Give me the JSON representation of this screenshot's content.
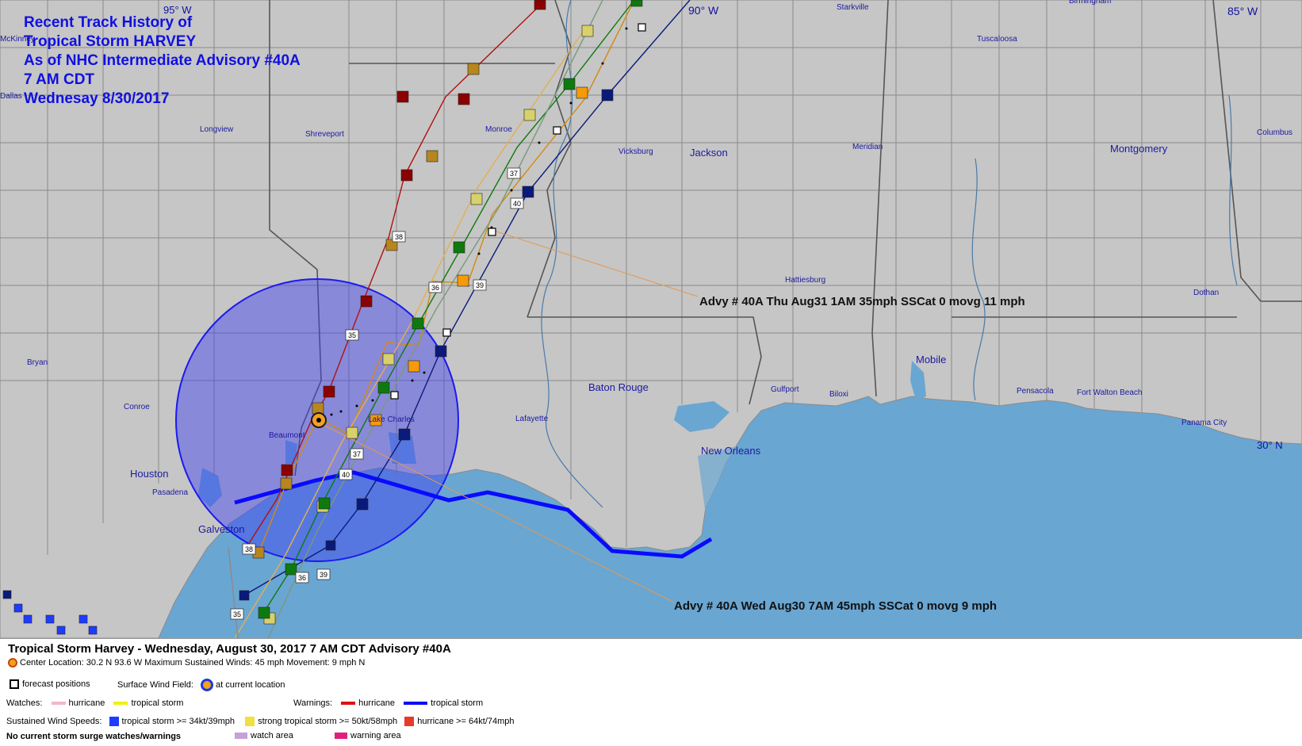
{
  "map": {
    "title_lines": [
      "Recent Track History of",
      "Tropical Storm HARVEY",
      "As of NHC Intermediate Advisory #40A",
      "7 AM CDT",
      "Wednesay 8/30/2017"
    ],
    "lon_labels": [
      "95° W",
      "90° W",
      "85° W"
    ],
    "lat_labels": [
      "30° N"
    ],
    "cities_large": [
      "Jackson",
      "Montgomery",
      "Houston",
      "Baton Rouge",
      "New Orleans",
      "Mobile",
      "Galveston"
    ],
    "cities_small": [
      "McKinney",
      "Dallas",
      "Starkville",
      "Tuscaloosa",
      "Birmingham",
      "Longview",
      "Shreveport",
      "Monroe",
      "Vicksburg",
      "Meridian",
      "Columbus",
      "Hattiesburg",
      "Dothan",
      "Bryan",
      "Conroe",
      "Pasadena",
      "Beaumont",
      "Lake Charles",
      "Lafayette",
      "Gulfport",
      "Biloxi",
      "Pensacola",
      "Fort Walton Beach",
      "Panama City"
    ],
    "advisory_labels": [
      "Advy # 40A Thu Aug31 1AM  35mph SSCat 0 movg 11 mph",
      "Advy # 40A Wed Aug30 7AM  45mph SSCat 0 movg 9 mph"
    ],
    "track_numbers": [
      "35",
      "36",
      "37",
      "38",
      "39",
      "40"
    ],
    "colors": {
      "land": "#c6c6c6",
      "water": "#6aa6d2",
      "wind_field": "#3d3df0",
      "warning_ts": "#0a0aff",
      "title_text": "#1010e0",
      "hurricane_square": "#8b0000",
      "strong_ts_square": "#c98a1e",
      "ts_square_green": "#0e7a0e",
      "ts_square_navy": "#0a1a7a",
      "ts_square_orange": "#f59a08"
    }
  },
  "legend": {
    "title": "Tropical Storm Harvey  -  Wednesday, August 30, 2017  7 AM CDT   Advisory #40A",
    "center_line": "Center Location: 30.2 N  93.6 W   Maximum Sustained Winds: 45 mph  Movement: 9 mph N",
    "forecast_positions": "forecast positions",
    "surface_wind_field_label": "Surface Wind Field:",
    "at_current_location": "at current location",
    "warnings_label": "Warnings:",
    "warning_hurricane": "hurricane",
    "warning_tropical_storm": "tropical storm",
    "watches_label": "Watches:",
    "watch_hurricane": "hurricane",
    "watch_tropical_storm": "tropical storm",
    "sustained_label": "Sustained Wind Speeds:",
    "ts_speed": "tropical storm >= 34kt/39mph",
    "strong_ts_speed": "strong tropical storm >= 50kt/58mph",
    "hurricane_speed": "hurricane >= 64kt/74mph",
    "surge_note": "No current storm surge watches/warnings",
    "watch_area": "watch area",
    "warning_area": "warning area",
    "colors": {
      "warning_hurricane": "#e01010",
      "warning_ts": "#0a0aff",
      "watch_hurricane": "#f5b6c6",
      "watch_ts": "#f0f010",
      "ts_speed": "#1e3cff",
      "strong_ts_speed": "#f0e040",
      "hurricane_speed": "#e83a2a",
      "watch_area": "#c8a0d8",
      "warning_area": "#e0207a"
    }
  }
}
